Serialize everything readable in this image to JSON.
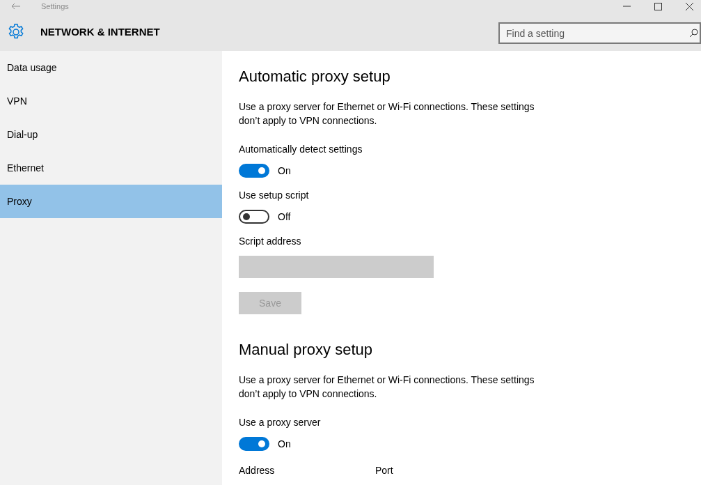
{
  "window": {
    "title": "Settings"
  },
  "header": {
    "title": "NETWORK & INTERNET",
    "search": {
      "placeholder": "Find a setting"
    }
  },
  "sidebar": {
    "items": [
      {
        "label": "Data usage",
        "selected": false
      },
      {
        "label": "VPN",
        "selected": false
      },
      {
        "label": "Dial-up",
        "selected": false
      },
      {
        "label": "Ethernet",
        "selected": false
      },
      {
        "label": "Proxy",
        "selected": true
      }
    ]
  },
  "content": [
    {
      "kind": "heading",
      "text": "Automatic proxy setup"
    },
    {
      "kind": "paragraph",
      "text": "Use a proxy server for Ethernet or Wi-Fi connections. These settings don’t apply to VPN connections."
    },
    {
      "kind": "toggle",
      "label": "Automatically detect settings",
      "on": true,
      "state_text": "On"
    },
    {
      "kind": "toggle",
      "label": "Use setup script",
      "on": false,
      "state_text": "Off"
    },
    {
      "kind": "field",
      "label": "Script address",
      "disabled": true
    },
    {
      "kind": "button",
      "label": "Save",
      "disabled": true
    },
    {
      "kind": "heading",
      "text": "Manual proxy setup"
    },
    {
      "kind": "paragraph",
      "text": "Use a proxy server for Ethernet or Wi-Fi connections. These settings don’t apply to VPN connections."
    },
    {
      "kind": "toggle",
      "label": "Use a proxy server",
      "on": true,
      "state_text": "On"
    },
    {
      "kind": "labels",
      "labels": [
        "Address",
        "Port"
      ]
    }
  ]
}
